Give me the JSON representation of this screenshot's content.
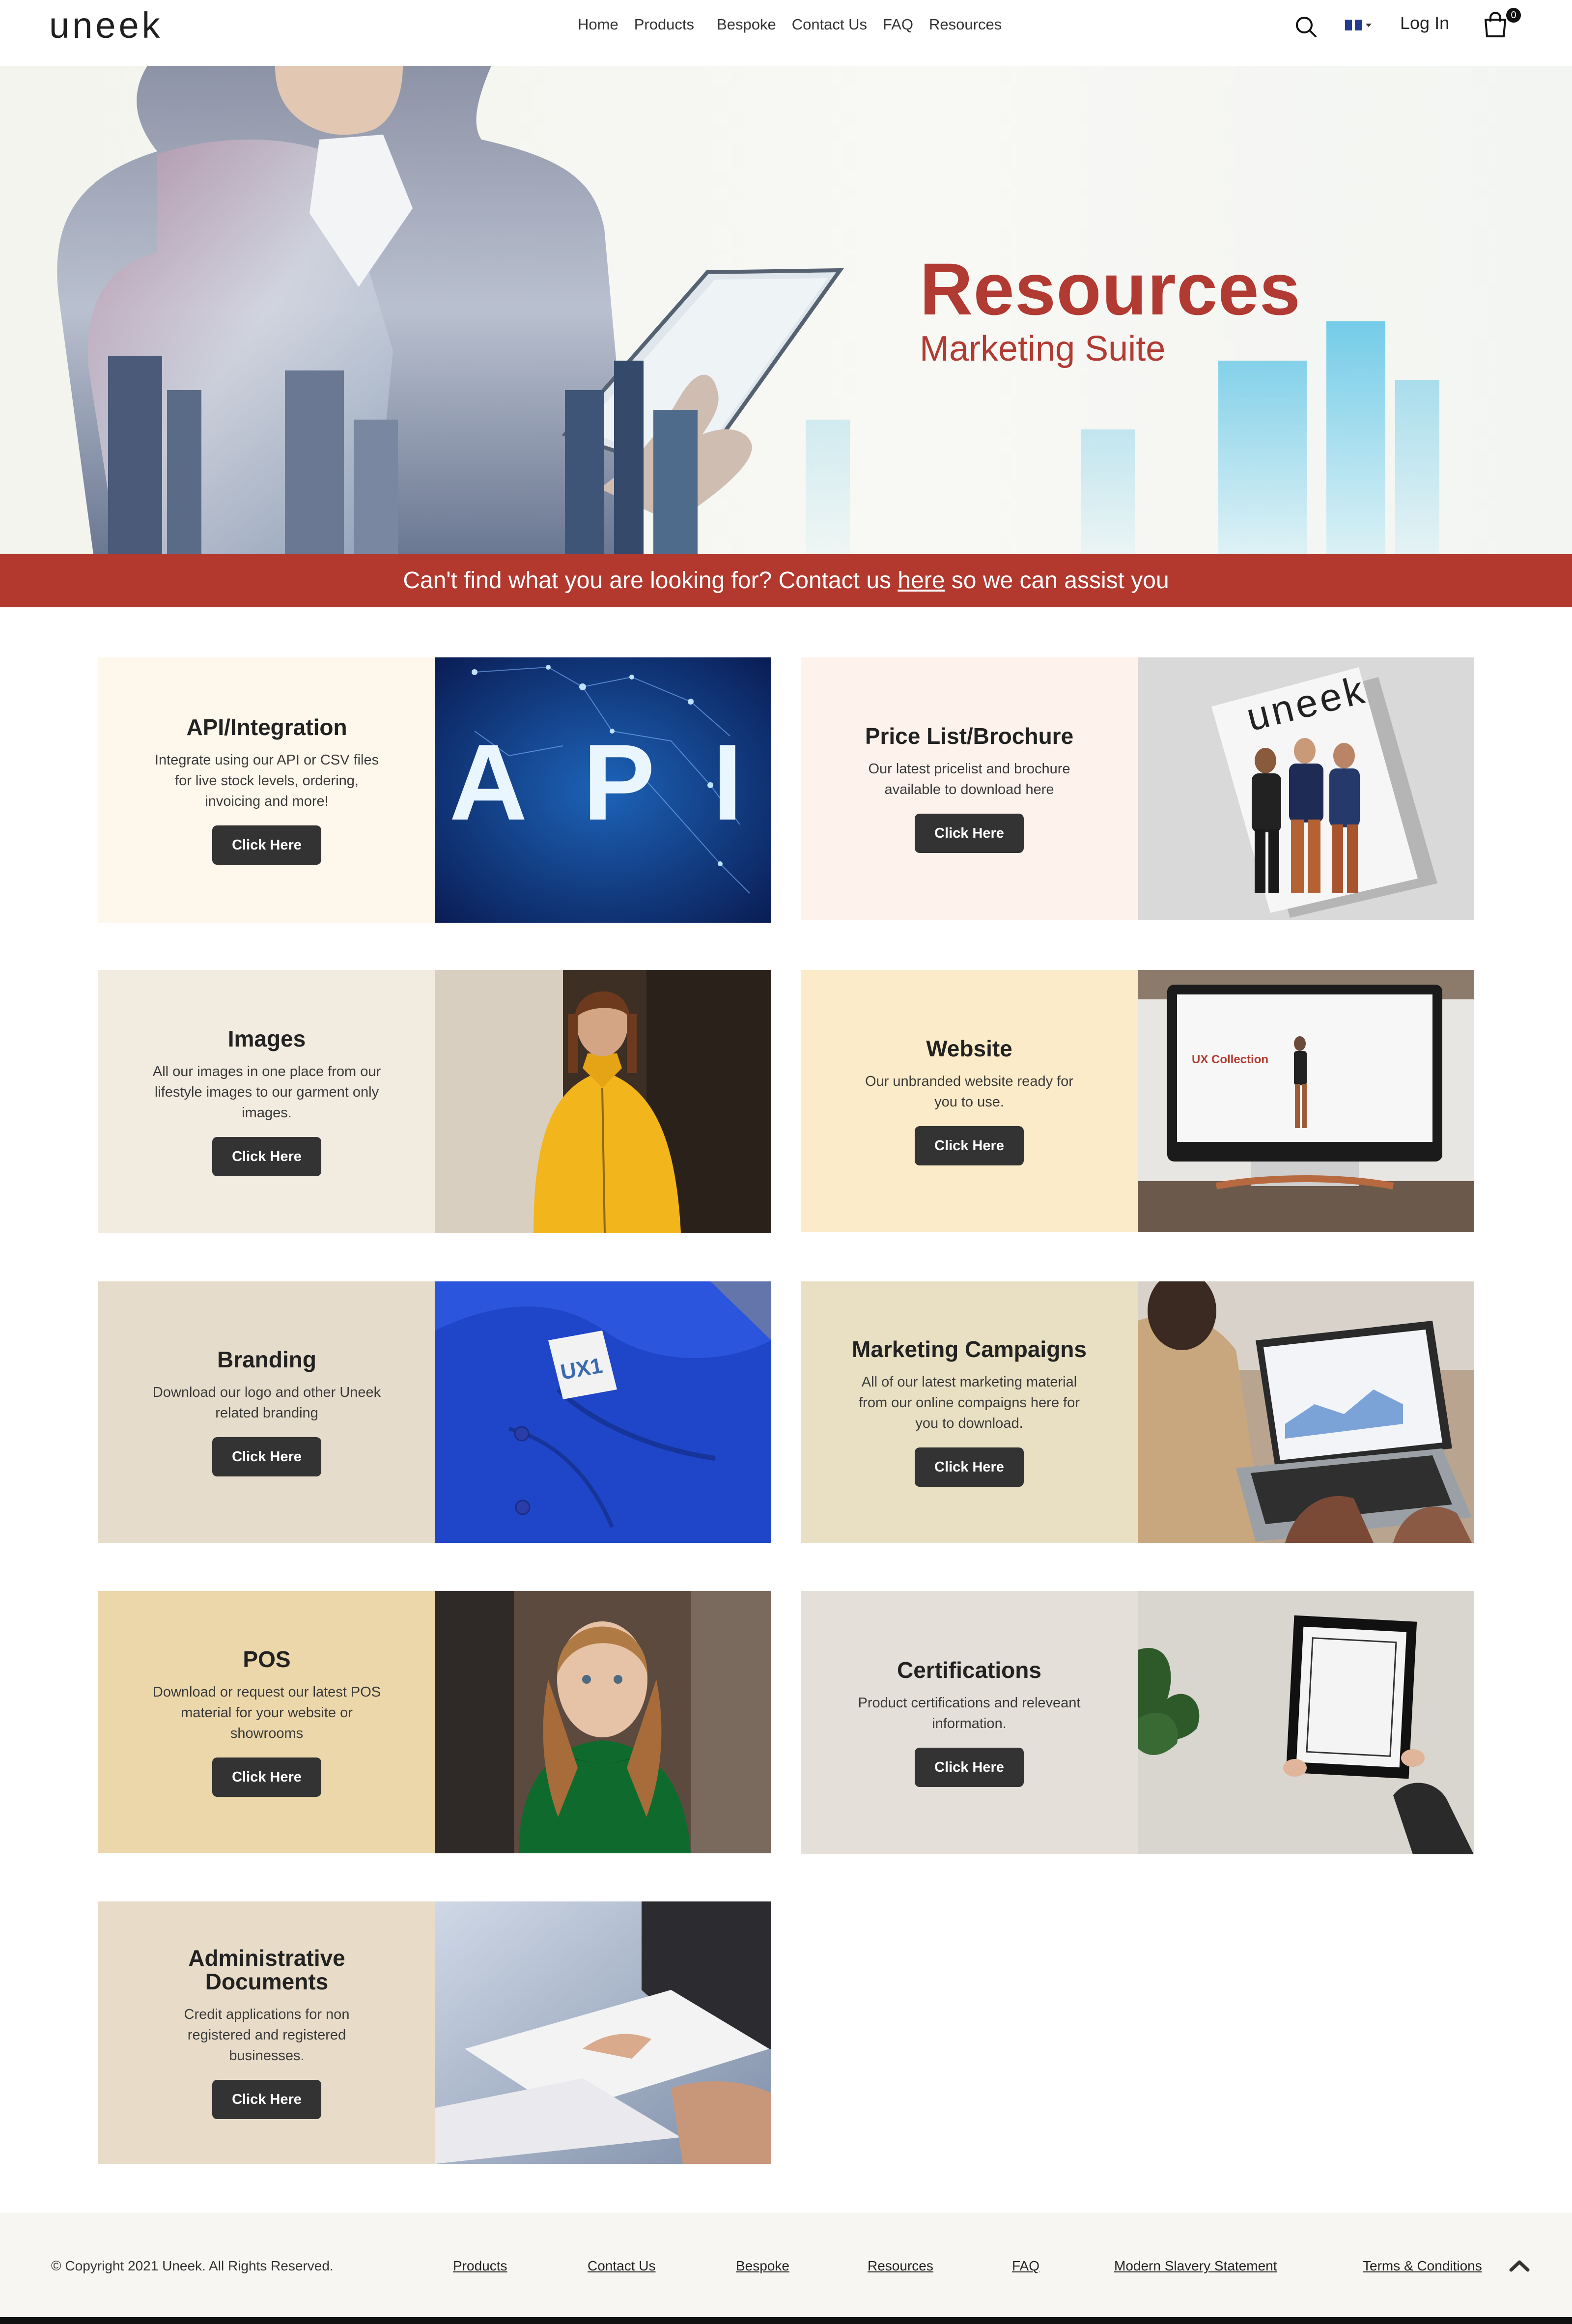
{
  "header": {
    "logo": "uneek",
    "nav": [
      "Home",
      "Products",
      "Bespoke",
      "Contact Us",
      "FAQ",
      "Resources"
    ],
    "login": "Log In",
    "cart_count": "0",
    "icons": [
      "search-icon",
      "uk-flag-icon",
      "cart-icon"
    ]
  },
  "hero": {
    "title": "Resources",
    "subtitle": "Marketing Suite"
  },
  "banner": {
    "before": "Can't find what you are looking for? Contact us ",
    "link": "here",
    "after": " so we can assist you"
  },
  "cards": [
    {
      "title": "API/Integration",
      "desc": "Integrate using our API or CSV files for live stock levels, ordering, invoicing and more!",
      "button": "Click Here",
      "bg": "#fdf7ec",
      "image_text": "A P I"
    },
    {
      "title": "Price List/Brochure",
      "desc": "Our latest pricelist and brochure available to download here",
      "button": "Click Here",
      "bg": "#fdf2ec",
      "image_text": "uneek"
    },
    {
      "title": "Images",
      "desc": "All our images in one place from our lifestyle images to our garment only images.",
      "button": "Click Here",
      "bg": "#f1ebe0"
    },
    {
      "title": "Website",
      "desc": "Our unbranded website ready for you to use.",
      "button": "Click Here",
      "bg": "#fcebc9",
      "image_text": "UX Collection"
    },
    {
      "title": "Branding",
      "desc": "Download our logo and other Uneek related branding",
      "button": "Click Here",
      "bg": "#e6dccb",
      "image_text": "UX1"
    },
    {
      "title": "Marketing Campaigns",
      "desc": "All of our latest marketing material from our online compaigns here for you to download.",
      "button": "Click Here",
      "bg": "#e9e0c4"
    },
    {
      "title": "POS",
      "desc": "Download or request our latest POS material for your website or showrooms",
      "button": "Click Here",
      "bg": "#ecd7ab"
    },
    {
      "title": "Certifications",
      "desc": "Product certifications and releveant information.",
      "button": "Click Here",
      "bg": "#e4e0d9"
    },
    {
      "title": "Administrative Documents",
      "desc": "Credit applications for non registered and registered businesses.",
      "button": "Click Here",
      "bg": "#e8dcc9"
    }
  ],
  "footer": {
    "copyright": "© Copyright 2021 Uneek. All Rights Reserved.",
    "links": [
      "Products",
      "Contact Us",
      "Bespoke",
      "Resources",
      "FAQ",
      "Modern Slavery Statement",
      "Terms & Conditions"
    ]
  },
  "colors": {
    "accent": "#b3392f",
    "button": "#333333"
  }
}
